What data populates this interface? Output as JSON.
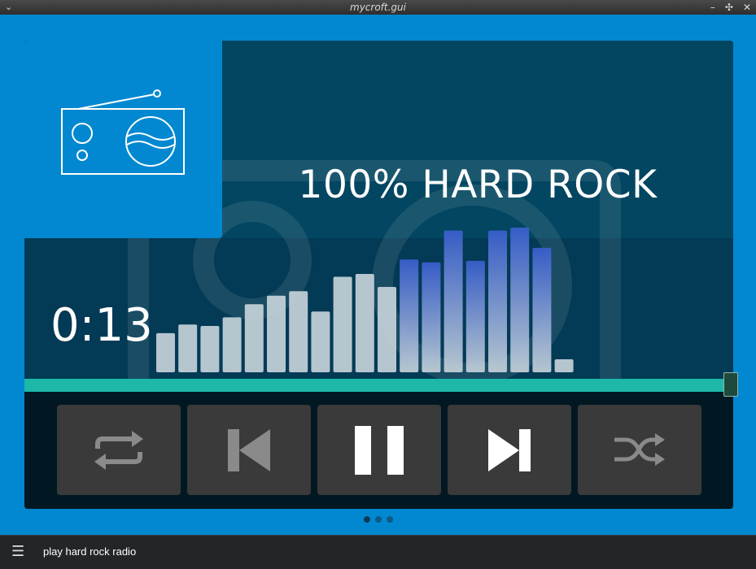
{
  "window": {
    "title": "mycroft.gui",
    "menu_glyph": "⌄",
    "minimize_glyph": "–",
    "pin_glyph": "✣",
    "close_glyph": "✕"
  },
  "player": {
    "station_title": "100% HARD ROCK",
    "elapsed": "0:13",
    "artwork_icon": "radio-icon",
    "progress_fraction": 1.0,
    "spectrum_levels": [
      0.27,
      0.33,
      0.32,
      0.38,
      0.47,
      0.53,
      0.56,
      0.42,
      0.66,
      0.68,
      0.59,
      0.78,
      0.76,
      0.98,
      0.77,
      0.98,
      1.0,
      0.86,
      0.09
    ],
    "spectrum_color": "#c5d2da",
    "spectrum_peak_color": "#3a5fcf",
    "controls": [
      {
        "name": "repeat-button",
        "icon": "repeat-icon"
      },
      {
        "name": "previous-button",
        "icon": "skip-previous-icon"
      },
      {
        "name": "pause-button",
        "icon": "pause-icon"
      },
      {
        "name": "next-button",
        "icon": "skip-next-icon"
      },
      {
        "name": "shuffle-button",
        "icon": "shuffle-icon"
      }
    ]
  },
  "pager": {
    "count": 3,
    "active": 0
  },
  "bottom_bar": {
    "menu_icon": "hamburger-menu-icon",
    "utterance": "play hard rock radio"
  },
  "colors": {
    "background": "#0288d1",
    "progress": "#1db8a8",
    "control_button": "#3a3a3a"
  }
}
